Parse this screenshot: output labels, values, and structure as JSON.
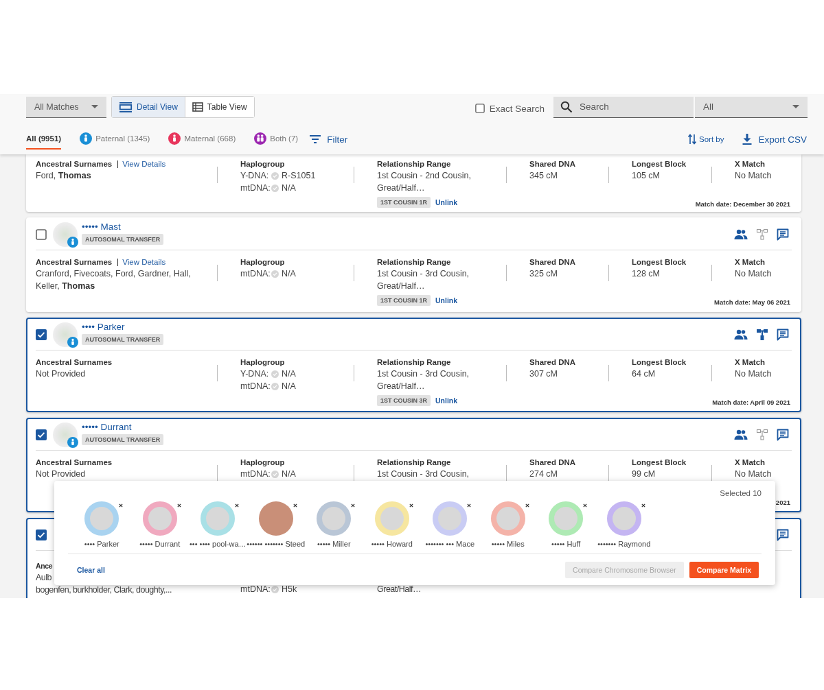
{
  "toolbar": {
    "match_filter": "All Matches",
    "views": [
      {
        "kind": "detail",
        "label": "Detail View",
        "selected": true
      },
      {
        "kind": "table",
        "label": "Table View",
        "selected": false
      }
    ],
    "exact_search": {
      "label": "Exact Search",
      "checked": false
    },
    "search": {
      "placeholder": "Search"
    },
    "search_scope": "All"
  },
  "tabs": [
    {
      "kind": "all",
      "label": "All (9951)",
      "selected": true
    },
    {
      "kind": "paternal",
      "label": "Paternal (1345)",
      "selected": false
    },
    {
      "kind": "maternal",
      "label": "Maternal (668)",
      "selected": false
    },
    {
      "kind": "both",
      "label": "Both (7)",
      "selected": false
    }
  ],
  "filter": "Filter",
  "sort": "Sort by",
  "export": "Export CSV",
  "matches": [
    {
      "surnames": {
        "label": "Ancestral Surnames",
        "link": "View Details",
        "lines": [
          "Ford, **Thomas**"
        ]
      },
      "haplogroup": {
        "label": "Haplogroup",
        "entries": [
          {
            "key": "Y-DNA:",
            "value": "R-S1051"
          },
          {
            "key": "mtDNA:",
            "value": "N/A"
          }
        ]
      },
      "relationship": {
        "label": "Relationship Range",
        "lines": [
          "1st Cousin - 2nd Cousin,",
          "Great/Half…"
        ],
        "badge": "1ST COUSIN 1R",
        "link": "Unlink"
      },
      "stats": [
        {
          "label": "Shared DNA",
          "value": "345 cM"
        },
        {
          "label": "Longest Block",
          "value": "105 cM"
        },
        {
          "label": "X Match",
          "value": "No Match"
        }
      ],
      "match_date": "Match date: December 30 2021"
    },
    {
      "header": {
        "name": "••••• Mast",
        "tag": "AUTOSOMAL TRANSFER",
        "checked": false,
        "icons": [
          {
            "kind": "people"
          },
          {
            "kind": "tree",
            "linked": false
          },
          {
            "kind": "chat"
          }
        ]
      },
      "surnames": {
        "label": "Ancestral Surnames",
        "link": "View Details",
        "lines": [
          "Cranford, Fivecoats, Ford, Gardner, Hall,",
          "Keller, **Thomas**"
        ]
      },
      "haplogroup": {
        "label": "Haplogroup",
        "entries": [
          {
            "key": "mtDNA:",
            "value": "N/A"
          }
        ]
      },
      "relationship": {
        "label": "Relationship Range",
        "lines": [
          "1st Cousin - 3rd Cousin,",
          "Great/Half…"
        ],
        "badge": "1ST COUSIN 1R",
        "link": "Unlink"
      },
      "stats": [
        {
          "label": "Shared DNA",
          "value": "325 cM"
        },
        {
          "label": "Longest Block",
          "value": "128 cM"
        },
        {
          "label": "X Match",
          "value": "No Match"
        }
      ],
      "match_date": "Match date: May 06 2021"
    },
    {
      "header": {
        "name": "•••• Parker",
        "tag": "AUTOSOMAL TRANSFER",
        "checked": true,
        "icons": [
          {
            "kind": "people"
          },
          {
            "kind": "tree",
            "linked": true
          },
          {
            "kind": "chat"
          }
        ]
      },
      "surnames": {
        "label": "Ancestral Surnames",
        "lines": [
          "Not Provided"
        ]
      },
      "haplogroup": {
        "label": "Haplogroup",
        "entries": [
          {
            "key": "Y-DNA:",
            "value": "N/A"
          },
          {
            "key": "mtDNA:",
            "value": "N/A"
          }
        ]
      },
      "relationship": {
        "label": "Relationship Range",
        "lines": [
          "1st Cousin - 3rd Cousin,",
          "Great/Half…"
        ],
        "badge": "1ST COUSIN 3R",
        "link": "Unlink"
      },
      "stats": [
        {
          "label": "Shared DNA",
          "value": "307 cM"
        },
        {
          "label": "Longest Block",
          "value": "64 cM"
        },
        {
          "label": "X Match",
          "value": "No Match"
        }
      ],
      "match_date": "Match date: April 09 2021"
    },
    {
      "header": {
        "name": "••••• Durrant",
        "tag": "AUTOSOMAL TRANSFER",
        "checked": true,
        "icons": [
          {
            "kind": "people"
          },
          {
            "kind": "tree",
            "linked": false
          },
          {
            "kind": "chat"
          }
        ]
      },
      "surnames": {
        "label": "Ancestral Surnames",
        "lines": [
          "Not Provided"
        ]
      },
      "haplogroup": {
        "label": "Haplogroup",
        "entries": [
          {
            "key": "mtDNA:",
            "value": "N/A"
          }
        ]
      },
      "relationship": {
        "label": "Relationship Range",
        "lines": [
          "1st Cousin - 3rd Cousin,"
        ]
      },
      "stats": [
        {
          "label": "Shared DNA",
          "value": "274 cM"
        },
        {
          "label": "Longest Block",
          "value": "99 cM"
        },
        {
          "label": "X Match",
          "value": "No Match"
        }
      ],
      "match_date": "2021"
    },
    {
      "header": {
        "checked": true,
        "icons": [
          {
            "kind": "chat"
          }
        ]
      },
      "surnames": {
        "label": "Ance",
        "lines": [
          "Aulb",
          "bogenfen, burkholder, Clark, doughty,..."
        ]
      },
      "haplogroup": {
        "entries": [
          {
            "key": "mtDNA:",
            "value": "H5k"
          }
        ]
      },
      "relationship": {
        "lines": [
          "Great/Half…"
        ]
      }
    }
  ],
  "selection": {
    "count_label": "Selected 10",
    "items": [
      {
        "name": "•••• Parker",
        "kind": "avatar",
        "color": "#a9d3f0"
      },
      {
        "name": "••••• Durrant",
        "kind": "avatar",
        "color": "#f0a9bf"
      },
      {
        "name": "••• •••• pool-wa…",
        "kind": "avatar",
        "color": "#a9e0e6"
      },
      {
        "name": "•••••• ••••••• Steed",
        "kind": "photo",
        "color": "#c98f78"
      },
      {
        "name": "••••• Miller",
        "kind": "avatar",
        "color": "#b9c6d6"
      },
      {
        "name": "••••• Howard",
        "kind": "avatar",
        "color": "#f6e6a0"
      },
      {
        "name": "••••••• ••• Mace",
        "kind": "avatar",
        "color": "#c9ccf4"
      },
      {
        "name": "••••• Miles",
        "kind": "avatar",
        "color": "#f4b3a9"
      },
      {
        "name": "••••• Huff",
        "kind": "avatar",
        "color": "#aeeab4"
      },
      {
        "name": "••••••• Raymond",
        "kind": "avatar",
        "color": "#c4b5f2"
      }
    ],
    "clear": "Clear all",
    "buttons": [
      {
        "label": "Compare Chromosome Browser",
        "disabled": true
      },
      {
        "label": "Compare Matrix",
        "disabled": false
      }
    ]
  }
}
